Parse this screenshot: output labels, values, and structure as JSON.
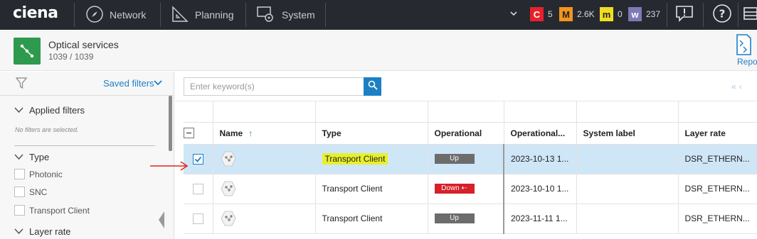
{
  "topbar": {
    "logo": "ciena",
    "nav": [
      {
        "label": "Network",
        "icon": "compass-icon"
      },
      {
        "label": "Planning",
        "icon": "ruler-icon"
      },
      {
        "label": "System",
        "icon": "gear-monitor-icon"
      }
    ],
    "alarms": [
      {
        "letter": "C",
        "count": "5",
        "color": "#e8202a",
        "text_color": "#ffffff"
      },
      {
        "letter": "M",
        "count": "2.6K",
        "color": "#f2941d",
        "text_color": "#222222"
      },
      {
        "letter": "m",
        "count": "0",
        "color": "#f0dc25",
        "text_color": "#222222"
      },
      {
        "letter": "w",
        "count": "237",
        "color": "#7f79b7",
        "text_color": "#ffffff"
      }
    ]
  },
  "header": {
    "title": "Optical services",
    "count": "1039 / 1039",
    "report_label": "Repo"
  },
  "sidebar": {
    "saved_filters": "Saved filters",
    "applied_filters": "Applied filters",
    "no_filters": "No filters are selected.",
    "type_section": "Type",
    "type_options": [
      "Photonic",
      "SNC",
      "Transport Client"
    ],
    "layer_rate": "Layer rate"
  },
  "search": {
    "placeholder": "Enter keyword(s)"
  },
  "grid": {
    "columns": [
      "Name",
      "Type",
      "Operational",
      "Operational...",
      "System label",
      "Layer rate"
    ],
    "rows": [
      {
        "selected": true,
        "type": "Transport Client",
        "operational": "Up",
        "op_date": "2023-10-13 1...",
        "system_label": "",
        "layer_rate": "DSR_ETHERN..."
      },
      {
        "selected": false,
        "type": "Transport Client",
        "operational": "Down",
        "op_date": "2023-10-10 1...",
        "system_label": "",
        "layer_rate": "DSR_ETHERN..."
      },
      {
        "selected": false,
        "type": "Transport Client",
        "operational": "Up",
        "op_date": "2023-11-11 1...",
        "system_label": "",
        "layer_rate": "DSR_ETHERN..."
      }
    ]
  },
  "colors": {
    "topbar": "#262a30",
    "accent": "#1d7fc4",
    "service_icon": "#2e9a4e",
    "selected_row": "#cfe6f7",
    "highlight": "#e8f02a",
    "status_up": "#6c6c6c",
    "status_down": "#d6202a"
  }
}
